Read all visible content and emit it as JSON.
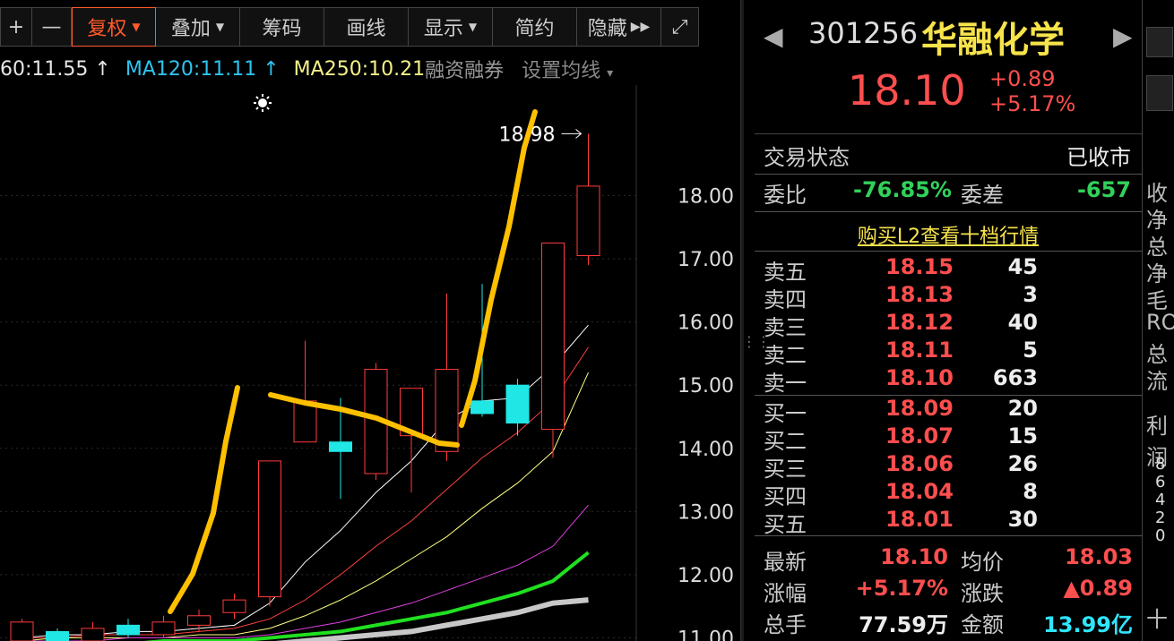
{
  "toolbar": {
    "plus": "+",
    "minus": "—",
    "fuquan": "复权",
    "diejia": "叠加",
    "chouma": "筹码",
    "huaxian": "画线",
    "xianshi": "显示",
    "jianyue": "简约",
    "yincang": "隐藏",
    "ffw": "▶▶",
    "fullscreen_icon": "⤢"
  },
  "ma_row": {
    "ma60": "60:11.55 ↑",
    "ma120": "MA120:11.11 ↑",
    "ma250": "MA250:10.21",
    "rzrq": "融资融券",
    "setma": "设置均线",
    "caret": "▾"
  },
  "chart_data": {
    "type": "candlestick",
    "y_axis_labels": [
      "18.00",
      "17.00",
      "16.00",
      "15.00",
      "14.00",
      "13.00",
      "12.00",
      "11.00"
    ],
    "ylim": [
      10.95,
      19.75
    ],
    "high_marker": "18.98",
    "candles": [
      {
        "o": 10.95,
        "c": 11.25,
        "h": 11.3,
        "l": 10.9
      },
      {
        "o": 11.1,
        "c": 10.95,
        "h": 11.15,
        "l": 10.85
      },
      {
        "o": 10.95,
        "c": 11.15,
        "h": 11.25,
        "l": 10.9
      },
      {
        "o": 11.2,
        "c": 11.05,
        "h": 11.3,
        "l": 11.0
      },
      {
        "o": 11.05,
        "c": 11.25,
        "h": 11.35,
        "l": 11.0
      },
      {
        "o": 11.2,
        "c": 11.35,
        "h": 11.45,
        "l": 11.1
      },
      {
        "o": 11.4,
        "c": 11.6,
        "h": 11.7,
        "l": 11.3
      },
      {
        "o": 11.65,
        "c": 13.8,
        "h": 13.8,
        "l": 11.5
      },
      {
        "o": 14.1,
        "c": 14.75,
        "h": 15.7,
        "l": 14.1
      },
      {
        "o": 14.1,
        "c": 13.95,
        "h": 14.8,
        "l": 13.2
      },
      {
        "o": 13.6,
        "c": 15.25,
        "h": 15.35,
        "l": 13.5
      },
      {
        "o": 14.2,
        "c": 14.95,
        "h": 14.95,
        "l": 13.3
      },
      {
        "o": 13.95,
        "c": 15.25,
        "h": 16.45,
        "l": 13.8
      },
      {
        "o": 14.75,
        "c": 14.55,
        "h": 16.6,
        "l": 14.5
      },
      {
        "o": 15.0,
        "c": 14.4,
        "h": 15.1,
        "l": 14.2
      },
      {
        "o": 14.3,
        "c": 17.25,
        "h": 17.25,
        "l": 13.85
      },
      {
        "o": 17.05,
        "c": 18.15,
        "h": 18.98,
        "l": 16.9
      }
    ],
    "ma_lines": [
      {
        "color": "#ffffff",
        "values": [
          11.0,
          11.05,
          11.05,
          11.1,
          11.1,
          11.15,
          11.2,
          11.55,
          12.2,
          12.7,
          13.3,
          13.8,
          14.45,
          14.75,
          14.8,
          15.3,
          15.95
        ]
      },
      {
        "color": "#ff4040",
        "values": [
          11.0,
          11.0,
          11.05,
          11.05,
          11.05,
          11.1,
          11.15,
          11.3,
          11.6,
          12.0,
          12.45,
          12.85,
          13.35,
          13.85,
          14.25,
          14.75,
          15.6
        ]
      },
      {
        "color": "#ffff80",
        "values": [
          10.95,
          11.0,
          11.0,
          11.0,
          11.0,
          11.05,
          11.05,
          11.15,
          11.35,
          11.6,
          11.9,
          12.25,
          12.6,
          13.05,
          13.45,
          13.95,
          15.2
        ]
      },
      {
        "color": "#e040e0",
        "values": [
          10.95,
          10.95,
          10.95,
          11.0,
          11.0,
          11.0,
          11.0,
          11.05,
          11.15,
          11.25,
          11.4,
          11.55,
          11.75,
          11.95,
          12.15,
          12.45,
          13.1
        ]
      },
      {
        "color": "#20e020",
        "values": [
          10.9,
          10.9,
          10.9,
          10.9,
          10.95,
          10.95,
          10.95,
          11.0,
          11.05,
          11.1,
          11.2,
          11.3,
          11.4,
          11.55,
          11.7,
          11.9,
          12.35
        ]
      },
      {
        "color": "#c8c8c8",
        "values": [
          10.85,
          10.85,
          10.85,
          10.85,
          10.85,
          10.85,
          10.85,
          10.9,
          10.95,
          11.0,
          11.05,
          11.1,
          11.2,
          11.3,
          11.4,
          11.55,
          11.6
        ]
      }
    ]
  },
  "quote": {
    "code": "301256",
    "name": "华融化学",
    "price": "18.10",
    "change": "+0.89",
    "change_pct": "+5.17%",
    "status_label": "交易状态",
    "status_value": "已收市",
    "weibi_label": "委比",
    "weibi_value": "-76.85%",
    "weicha_label": "委差",
    "weicha_value": "-657",
    "l2_link": "购买L2查看十档行情"
  },
  "orderbook": {
    "asks": [
      {
        "label": "卖五",
        "price": "18.15",
        "vol": "45"
      },
      {
        "label": "卖四",
        "price": "18.13",
        "vol": "3"
      },
      {
        "label": "卖三",
        "price": "18.12",
        "vol": "40"
      },
      {
        "label": "卖二",
        "price": "18.11",
        "vol": "5"
      },
      {
        "label": "卖一",
        "price": "18.10",
        "vol": "663"
      }
    ],
    "bids": [
      {
        "label": "买一",
        "price": "18.09",
        "vol": "20"
      },
      {
        "label": "买二",
        "price": "18.07",
        "vol": "15"
      },
      {
        "label": "买三",
        "price": "18.06",
        "vol": "26"
      },
      {
        "label": "买四",
        "price": "18.04",
        "vol": "8"
      },
      {
        "label": "买五",
        "price": "18.01",
        "vol": "30"
      }
    ]
  },
  "stats": {
    "latest_label": "最新",
    "latest_value": "18.10",
    "avg_label": "均价",
    "avg_value": "18.03",
    "zf_label": "涨幅",
    "zf_value": "+5.17%",
    "zd_label": "涨跌",
    "zd_value": "▲0.89",
    "zs_label": "总手",
    "zs_value": "77.59万",
    "je_label": "金额",
    "je_value": "13.99亿"
  },
  "strip": {
    "labels": [
      "收",
      "净",
      "总",
      "净",
      "毛",
      "RO",
      "总",
      "流"
    ],
    "lirun": "利润",
    "nums": [
      "8",
      "6",
      "4",
      "2",
      "0"
    ],
    "bottom": "十"
  }
}
